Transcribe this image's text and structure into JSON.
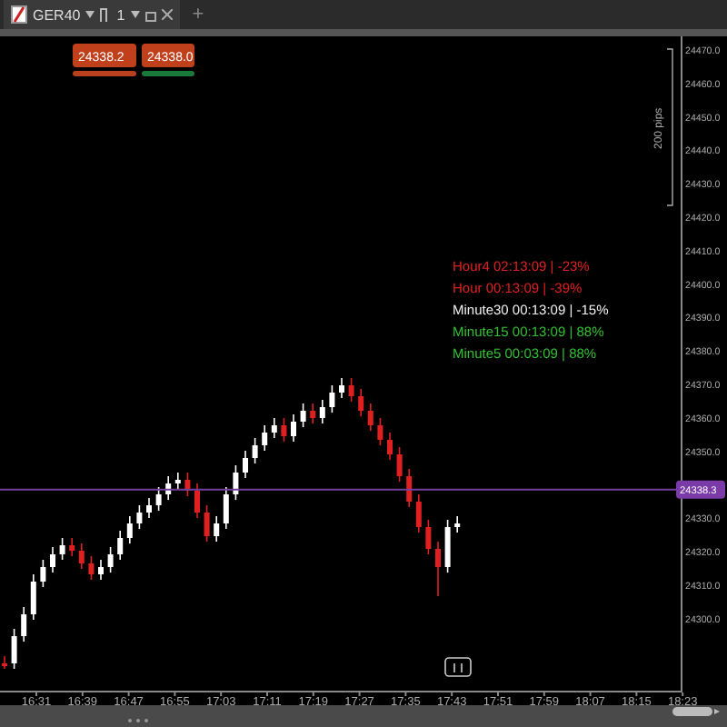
{
  "tab": {
    "symbol": "GER40",
    "timeframe": "1",
    "new_tab": "+"
  },
  "trade_buttons": [
    {
      "price": "24338.2",
      "kind": "sell"
    },
    {
      "price": "24338.0",
      "kind": "buy"
    }
  ],
  "price_axis": {
    "labels": [
      "24470.0",
      "24460.0",
      "24450.0",
      "24440.0",
      "24430.0",
      "24420.0",
      "24410.0",
      "24400.0",
      "24390.0",
      "24380.0",
      "24370.0",
      "24360.0",
      "24350.0",
      "24330.0",
      "24320.0",
      "24310.0",
      "24300.0"
    ],
    "current_price": "24338.3"
  },
  "scale_label": "200 pips",
  "time_axis": {
    "labels": [
      "16:31",
      "16:39",
      "16:47",
      "16:55",
      "17:03",
      "17:11",
      "17:19",
      "17:27",
      "17:35",
      "17:43",
      "17:51",
      "17:59",
      "18:07",
      "18:15",
      "18:23"
    ]
  },
  "timers": [
    {
      "text": "Hour4 02:13:09 | -23%",
      "color": "#e02020"
    },
    {
      "text": "Hour 00:13:09 | -39%",
      "color": "#e02020"
    },
    {
      "text": "Minute30 00:13:09 | -15%",
      "color": "#f0f0f0"
    },
    {
      "text": "Minute15 00:13:09 | 88%",
      "color": "#30c030"
    },
    {
      "text": "Minute5 00:03:09 | 88%",
      "color": "#30c030"
    }
  ]
}
